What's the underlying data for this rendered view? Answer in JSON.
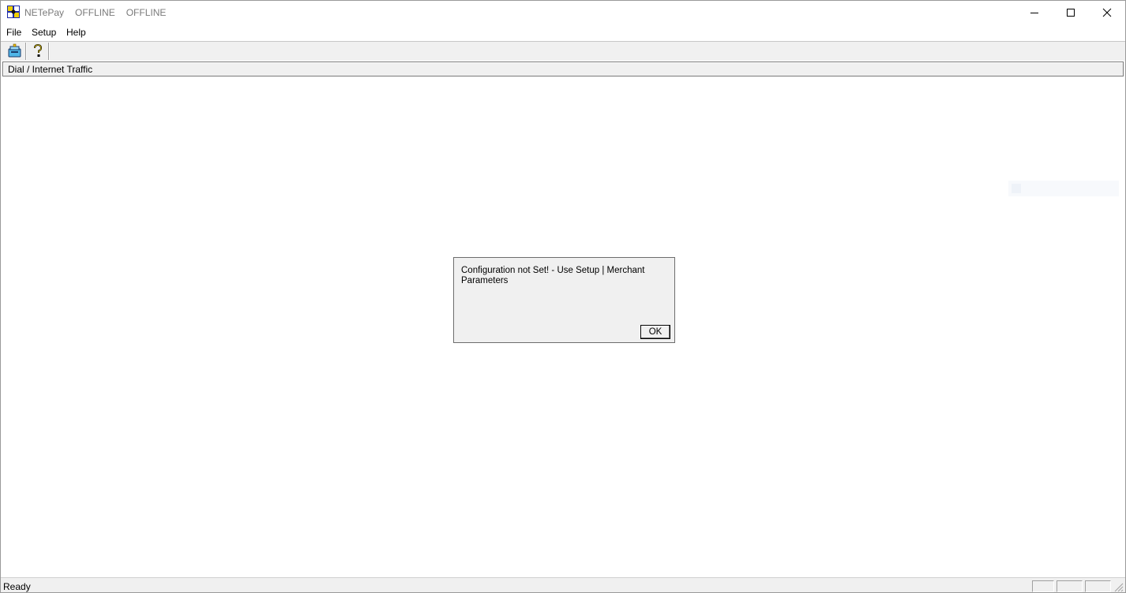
{
  "window": {
    "app_name": "NETePay",
    "status_1": "OFFLINE",
    "status_2": "OFFLINE"
  },
  "menu": {
    "items": [
      {
        "label": "File"
      },
      {
        "label": "Setup"
      },
      {
        "label": "Help"
      }
    ]
  },
  "toolbar": {
    "buttons": [
      {
        "icon": "connect-icon"
      },
      {
        "icon": "help-icon"
      }
    ]
  },
  "panel": {
    "header": "Dial / Internet Traffic"
  },
  "dialog": {
    "message": "Configuration not Set! - Use Setup | Merchant Parameters",
    "ok_label": "OK"
  },
  "statusbar": {
    "text": "Ready"
  }
}
